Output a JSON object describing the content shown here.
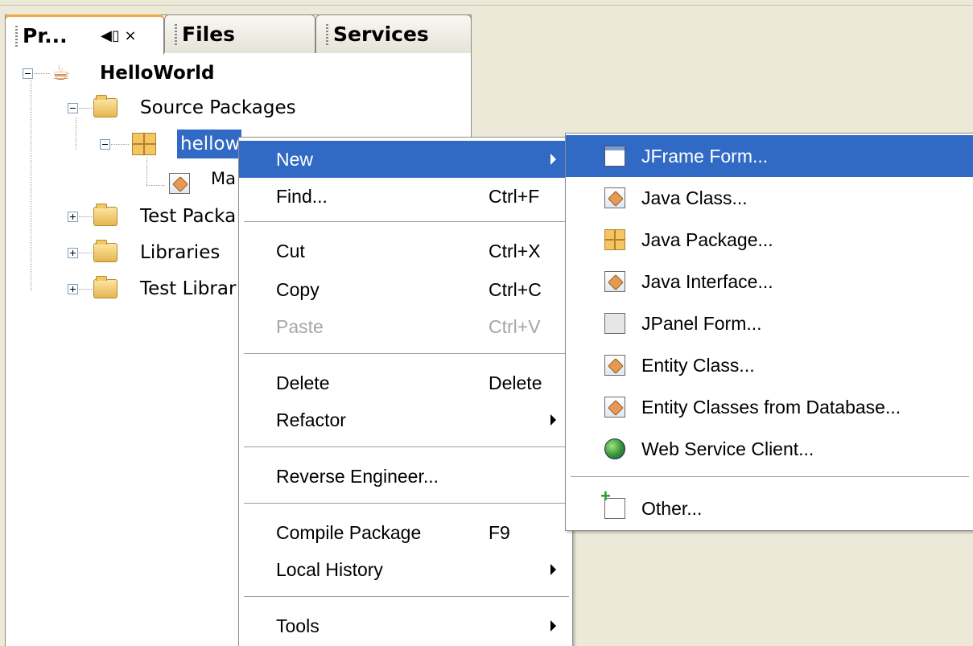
{
  "tabs": {
    "projects": "Pr...",
    "files": "Files",
    "services": "Services",
    "controls": "◀▯ ×"
  },
  "tree": {
    "project": "HelloWorld",
    "source_packages": "Source Packages",
    "package": "hellow",
    "main_class": "Ma",
    "test_packages": "Test Packa",
    "libraries": "Libraries",
    "test_libraries": "Test Librar"
  },
  "context_menu": {
    "new": "New",
    "find": "Find...",
    "find_shortcut": "Ctrl+F",
    "cut": "Cut",
    "cut_shortcut": "Ctrl+X",
    "copy": "Copy",
    "copy_shortcut": "Ctrl+C",
    "paste": "Paste",
    "paste_shortcut": "Ctrl+V",
    "delete": "Delete",
    "delete_shortcut": "Delete",
    "refactor": "Refactor",
    "reverse_engineer": "Reverse Engineer...",
    "compile_package": "Compile Package",
    "compile_shortcut": "F9",
    "local_history": "Local History",
    "tools": "Tools"
  },
  "new_submenu": {
    "jframe_form": "JFrame Form...",
    "java_class": "Java Class...",
    "java_package": "Java Package...",
    "java_interface": "Java Interface...",
    "jpanel_form": "JPanel Form...",
    "entity_class": "Entity Class...",
    "entity_classes_db": "Entity Classes from Database...",
    "web_service_client": "Web Service Client...",
    "other": "Other..."
  },
  "colors": {
    "selection": "#316ac5",
    "panel_bg": "#ece9d8",
    "tab_accent": "#f4a941"
  }
}
